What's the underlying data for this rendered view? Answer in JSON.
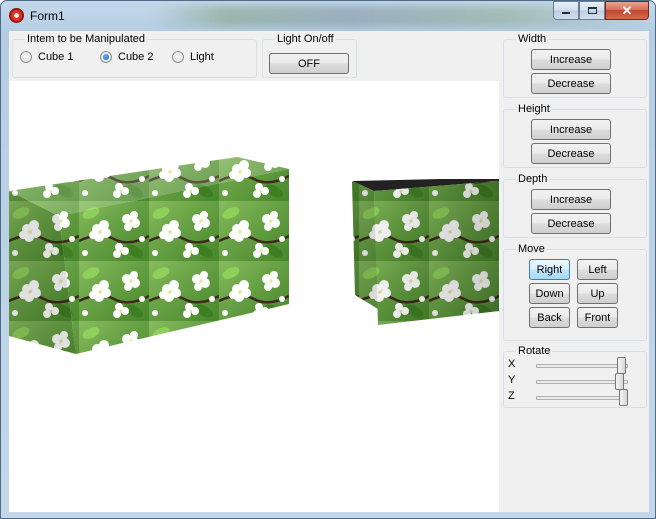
{
  "window": {
    "title": "Form1"
  },
  "controls": {
    "minimize": "minimize",
    "maximize": "maximize",
    "close": "close"
  },
  "manipulate": {
    "legend": "Intem to be Manipulated",
    "options": [
      {
        "label": "Cube 1",
        "selected": false
      },
      {
        "label": "Cube 2",
        "selected": true
      },
      {
        "label": "Light",
        "selected": false
      }
    ]
  },
  "light": {
    "legend": "Light On/off",
    "button": "OFF"
  },
  "width": {
    "legend": "Width",
    "increase": "Increase",
    "decrease": "Decrease"
  },
  "height": {
    "legend": "Height",
    "increase": "Increase",
    "decrease": "Decrease"
  },
  "depth": {
    "legend": "Depth",
    "increase": "Increase",
    "decrease": "Decrease"
  },
  "move": {
    "legend": "Move",
    "right": "Right",
    "left": "Left",
    "down": "Down",
    "up": "Up",
    "back": "Back",
    "front": "Front"
  },
  "rotate": {
    "legend": "Rotate",
    "sliders": [
      {
        "axis": "X",
        "value": 0.98
      },
      {
        "axis": "Y",
        "value": 0.95
      },
      {
        "axis": "Z",
        "value": 1.0
      }
    ]
  },
  "scene": {
    "objects": [
      "cube-1",
      "cube-2"
    ],
    "texture": "white cherry blossoms on green leaves"
  },
  "colors": {
    "titlebar": "#b9d1e8",
    "scene_background": "#ffffff",
    "panel": "#f0f0f0",
    "leaf_green": "#4c8a2a",
    "radio_selected": "#1a5fb4"
  }
}
